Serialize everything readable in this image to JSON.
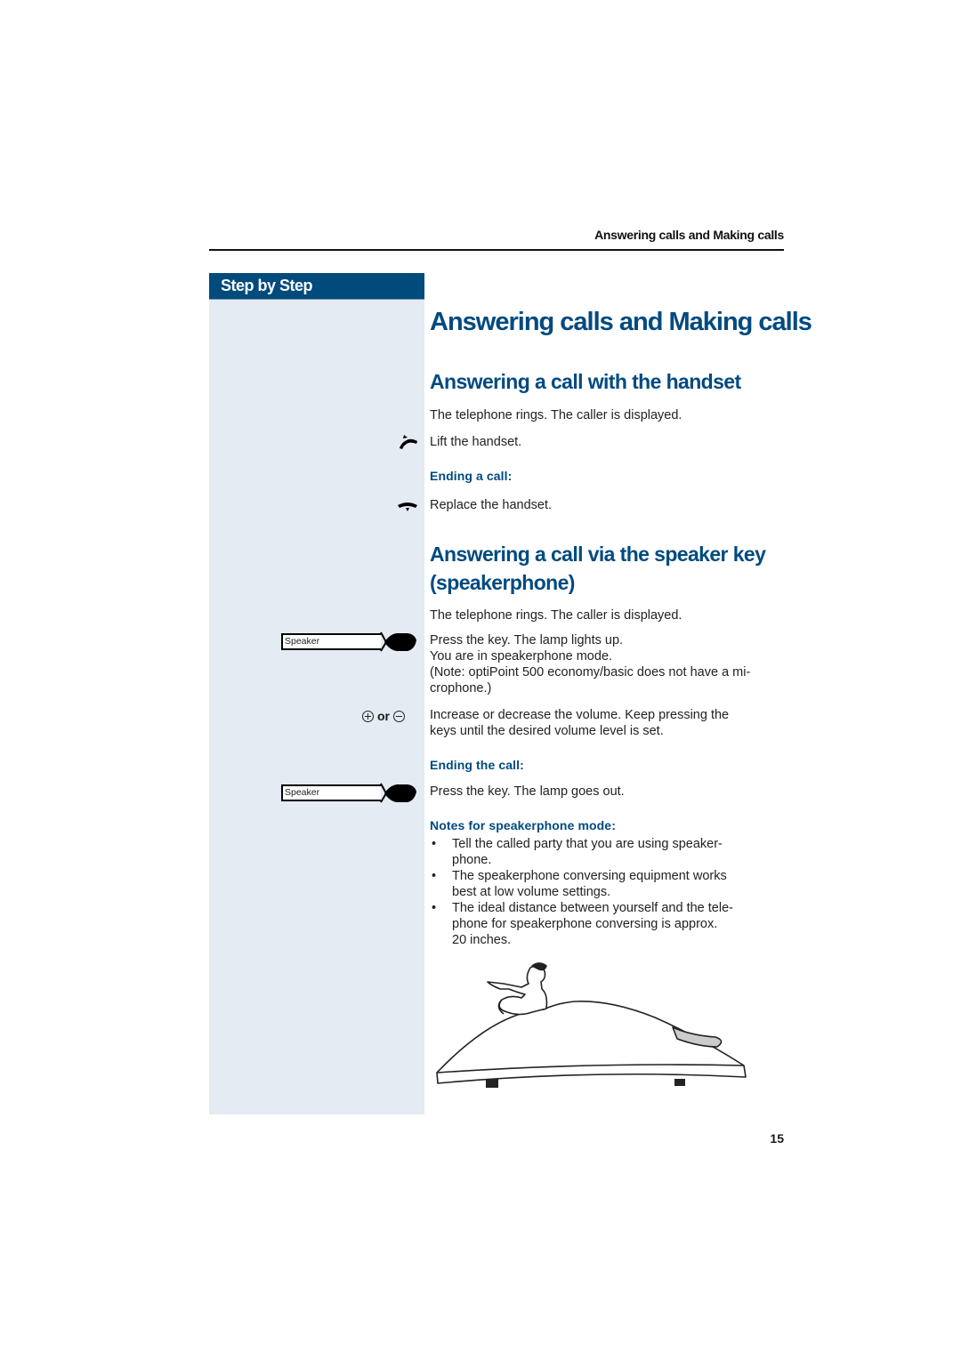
{
  "running_head": "Answering calls and Making calls",
  "sidebar": {
    "header": "Step by Step",
    "speaker_key_label": "Speaker",
    "or_label": "or",
    "icons": [
      "lift-handset-icon",
      "replace-handset-icon",
      "speaker-key-icon",
      "plus-key-icon",
      "minus-key-icon"
    ]
  },
  "title": "Answering calls and Making calls",
  "section1": {
    "heading": "Answering a call with the handset",
    "intro": "The telephone rings. The caller is displayed.",
    "lift": "Lift the handset.",
    "ending_heading": "Ending a call:",
    "replace": "Replace the handset."
  },
  "section2": {
    "heading_line1": "Answering a call via the speaker key",
    "heading_line2": "(speakerphone)",
    "intro": "The telephone rings. The caller is displayed.",
    "press_line1": "Press the key. The lamp lights up.",
    "press_line2": "You are in speakerphone mode.",
    "press_line3": "(Note: optiPoint 500 economy/basic does not have a mi-",
    "press_line4": "crophone.)",
    "volume_line1": "Increase or decrease the volume. Keep pressing the",
    "volume_line2": "keys until the desired volume level is set.",
    "ending_heading": "Ending the call:",
    "press_out": "Press the key. The lamp goes out.",
    "notes_heading": "Notes for speakerphone mode:",
    "notes": [
      [
        "Tell the called party that you are using speaker-",
        "phone."
      ],
      [
        "The speakerphone conversing equipment works",
        "best at low volume settings."
      ],
      [
        "The ideal distance between yourself and the tele-",
        "phone for speakerphone conversing is approx.",
        "20 inches."
      ]
    ]
  },
  "illustration": "person-sitting-on-telephone-illustration",
  "page_number": "15"
}
